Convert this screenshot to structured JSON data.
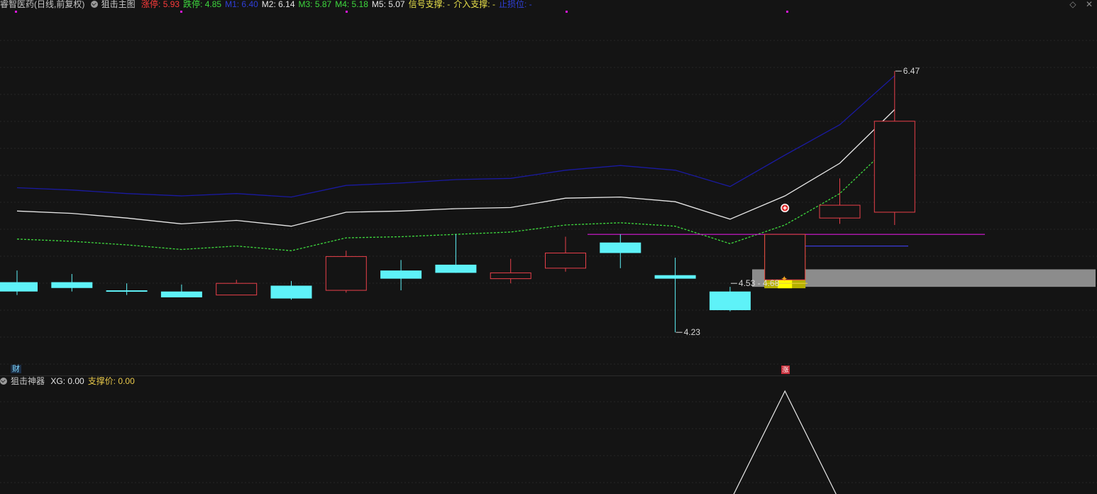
{
  "header": {
    "stock_name": "睿智医药(日线,前复权)",
    "indicator_name": "狙击主图",
    "items": [
      {
        "label": "涨停:",
        "value": "5.93",
        "color": "#ff3b3b"
      },
      {
        "label": "跌停:",
        "value": "4.85",
        "color": "#3ed93e"
      },
      {
        "label": "M1:",
        "value": "6.40",
        "color": "#2f3fd8"
      },
      {
        "label": "M2:",
        "value": "6.14",
        "color": "#e6e6e6"
      },
      {
        "label": "M3:",
        "value": "5.87",
        "color": "#3ed93e"
      },
      {
        "label": "M4:",
        "value": "5.18",
        "color": "#3ed93e"
      },
      {
        "label": "M5:",
        "value": "5.07",
        "color": "#e6e6e6"
      },
      {
        "label": "信号支撑:",
        "value": "-",
        "color": "#e8e04a"
      },
      {
        "label": "介入支撑:",
        "value": "-",
        "color": "#e8e04a"
      },
      {
        "label": "止损位:",
        "value": "-",
        "color": "#2f3fd8"
      }
    ]
  },
  "corner_icons": [
    "diamond-icon",
    "close-icon"
  ],
  "sub_panel": {
    "indicator_name": "狙击神器",
    "items": [
      {
        "label": "XG:",
        "value": "0.00",
        "color": "#e6e6e6"
      },
      {
        "label": "支撑价:",
        "value": "0.00",
        "color": "#e8c84a"
      }
    ]
  },
  "badges": {
    "finance": "财",
    "limit_up": "涨"
  },
  "colors": {
    "background": "#141414",
    "up": "#e8404a",
    "down": "#5ef2f8",
    "m1": "#1a1aa0",
    "m2": "#e8e8e8",
    "m3": "#3ed93e",
    "signal_bar": "#b5b000",
    "signal_bar_core": "#ffff00",
    "support_zone": "#8c8c8c",
    "horizontal_magenta": "#d818d8",
    "horizontal_blue": "#3a3ad8"
  },
  "chart_data": {
    "type": "candlestick",
    "ylim": [
      4.0,
      6.55
    ],
    "candles": [
      {
        "o": 4.66,
        "h": 4.76,
        "l": 4.55,
        "c": 4.58
      },
      {
        "o": 4.66,
        "h": 4.73,
        "l": 4.58,
        "c": 4.61
      },
      {
        "o": 4.59,
        "h": 4.65,
        "l": 4.55,
        "c": 4.58
      },
      {
        "o": 4.58,
        "h": 4.64,
        "l": 4.53,
        "c": 4.53
      },
      {
        "o": 4.55,
        "h": 4.68,
        "l": 4.55,
        "c": 4.65
      },
      {
        "o": 4.63,
        "h": 4.67,
        "l": 4.51,
        "c": 4.52
      },
      {
        "o": 4.59,
        "h": 4.93,
        "l": 4.57,
        "c": 4.88
      },
      {
        "o": 4.76,
        "h": 4.85,
        "l": 4.59,
        "c": 4.69
      },
      {
        "o": 4.81,
        "h": 5.07,
        "l": 4.74,
        "c": 4.74
      },
      {
        "o": 4.69,
        "h": 4.86,
        "l": 4.65,
        "c": 4.74
      },
      {
        "o": 4.78,
        "h": 5.05,
        "l": 4.75,
        "c": 4.91
      },
      {
        "o": 5.0,
        "h": 5.07,
        "l": 4.78,
        "c": 4.91
      },
      {
        "o": 4.72,
        "h": 4.87,
        "l": 4.23,
        "c": 4.69
      },
      {
        "o": 4.58,
        "h": 4.62,
        "l": 4.41,
        "c": 4.42
      },
      {
        "o": 4.68,
        "h": 5.07,
        "l": 4.68,
        "c": 5.07
      },
      {
        "o": 5.21,
        "h": 5.55,
        "l": 5.16,
        "c": 5.32
      },
      {
        "o": 5.26,
        "h": 6.47,
        "l": 5.15,
        "c": 6.04
      }
    ],
    "series": {
      "m1": [
        5.47,
        5.45,
        5.42,
        5.4,
        5.42,
        5.39,
        5.49,
        5.51,
        5.54,
        5.55,
        5.62,
        5.66,
        5.62,
        5.48,
        5.75,
        6.01,
        6.43
      ],
      "m2": [
        5.27,
        5.25,
        5.21,
        5.16,
        5.19,
        5.14,
        5.26,
        5.27,
        5.29,
        5.3,
        5.38,
        5.39,
        5.35,
        5.2,
        5.4,
        5.68,
        6.14
      ],
      "m3": [
        5.03,
        5.01,
        4.98,
        4.94,
        4.97,
        4.93,
        5.04,
        5.05,
        5.07,
        5.09,
        5.15,
        5.17,
        5.14,
        4.99,
        5.15,
        5.42,
        5.87
      ],
      "m4": [
        4.56,
        4.55,
        4.53,
        4.5,
        4.52,
        4.48,
        4.57,
        4.57,
        4.58,
        4.58,
        4.64,
        4.67,
        4.64,
        4.52,
        4.61,
        4.81,
        5.18
      ],
      "m5": [
        4.47,
        4.45,
        4.43,
        4.39,
        4.41,
        4.37,
        4.46,
        4.47,
        4.48,
        4.49,
        4.54,
        4.56,
        4.53,
        4.4,
        4.57,
        4.72,
        5.07
      ]
    },
    "annotations": [
      {
        "label": "6.47",
        "candle": 16,
        "price": 6.47
      },
      {
        "label": "4.23",
        "candle": 12,
        "price": 4.23
      },
      {
        "label": "4.53 - 4.68",
        "candle": 13,
        "price": 4.65
      }
    ],
    "support_zone": [
      4.62,
      4.77
    ],
    "signal_candle": 14,
    "magenta_level": 5.07,
    "blue_level": 4.97,
    "sub_signal_candle": 14
  }
}
